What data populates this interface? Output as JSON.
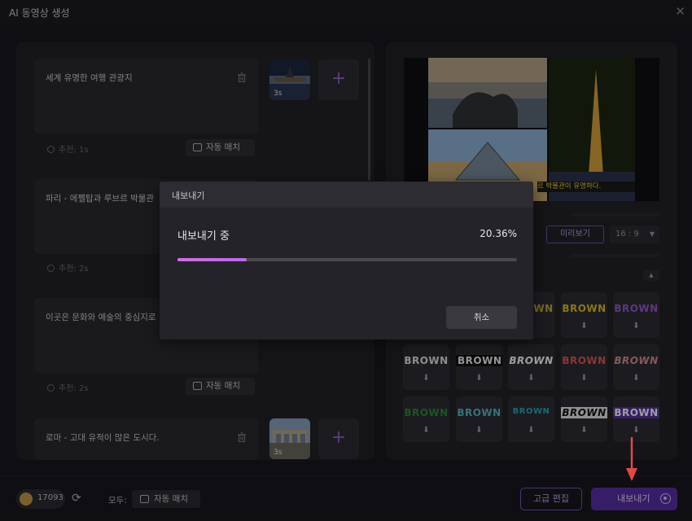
{
  "window": {
    "title": "AI 동영상 생성"
  },
  "scenes": [
    {
      "text": "세계 유명한 여행 관광지",
      "recommend": "추천: 1s",
      "duration": "3s",
      "auto_match": "자동 매치"
    },
    {
      "text": "파리 - 에펠탑과 루브르 박물관",
      "recommend": "추천: 2s"
    },
    {
      "text": "이곳은 문화와 예술의 중심지로",
      "recommend": "추천: 2s",
      "auto_match": "자동 매치"
    },
    {
      "text": "로마 - 고대 유적이 많은 도시다.",
      "duration": "3s"
    }
  ],
  "preview": {
    "subtitle_fragment": "브르 박물관이 유명하다.",
    "preview_button": "미리보기",
    "ratio": "16 : 9"
  },
  "text_styles": [
    {
      "label": "BROWN",
      "color": "#c8a838"
    },
    {
      "label": "BROWN",
      "color": "#e0c020"
    },
    {
      "label": "BROWN",
      "color": "#9a58d8"
    },
    {
      "label": "BROWN",
      "color": "#e6e6e6"
    },
    {
      "label": "BROWN",
      "color": "#f0f0f0"
    },
    {
      "label": "BROWN",
      "color": "#ffffff"
    },
    {
      "label": "BROWN",
      "color": "#e05a5a"
    },
    {
      "label": "BROWN",
      "color": "#d89090"
    },
    {
      "label": "BROWN",
      "color": "#2a8a3a"
    },
    {
      "label": "BROWN",
      "color": "#58b8c8"
    },
    {
      "label": "BROWN",
      "color": "#28a8b8"
    },
    {
      "label": "BROWN",
      "color": "#111111"
    },
    {
      "label": "BROWN",
      "color": "#ffffff"
    }
  ],
  "footer": {
    "credits": "17093",
    "all_label": "모두:",
    "auto_match": "자동 매치",
    "advanced_edit": "고급 편집",
    "export": "내보내기"
  },
  "dialog": {
    "title": "내보내기",
    "status": "내보내기 중",
    "percent_text": "20.36%",
    "progress": 0.2036,
    "cancel": "취소"
  },
  "colors": {
    "accent": "#5a2fa8",
    "progress": "#c96ae6",
    "arrow": "#e04848"
  }
}
